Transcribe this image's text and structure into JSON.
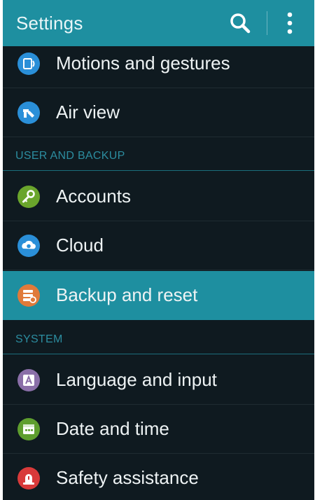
{
  "header": {
    "title": "Settings"
  },
  "items_top": [
    {
      "label": "Motions and gestures",
      "icon": "motions-icon",
      "color": "#2a8fd8"
    },
    {
      "label": "Air view",
      "icon": "air-view-icon",
      "color": "#2a8fd8"
    }
  ],
  "sections": {
    "user_backup": "USER AND BACKUP",
    "system": "SYSTEM"
  },
  "items_user": [
    {
      "label": "Accounts",
      "icon": "key-icon",
      "color": "#6aa52c"
    },
    {
      "label": "Cloud",
      "icon": "cloud-icon",
      "color": "#2a8fd8"
    },
    {
      "label": "Backup and reset",
      "icon": "backup-icon",
      "color": "#e07a3a",
      "selected": true
    }
  ],
  "items_system": [
    {
      "label": "Language and input",
      "icon": "language-icon",
      "color": "#8a6fa8"
    },
    {
      "label": "Date and time",
      "icon": "calendar-icon",
      "color": "#5e9e2e"
    },
    {
      "label": "Safety assistance",
      "icon": "safety-icon",
      "color": "#d83a3a"
    }
  ],
  "colors": {
    "accent": "#1e8fa0",
    "background": "#0f1a20",
    "section_text": "#2c8da0"
  }
}
